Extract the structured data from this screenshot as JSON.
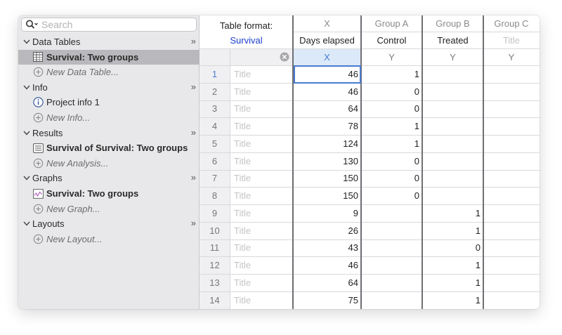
{
  "search": {
    "placeholder": "Search"
  },
  "sidebar": {
    "sections": [
      {
        "label": "Data Tables",
        "items": [
          {
            "label": "Survival: Two groups",
            "kind": "table",
            "selected": true,
            "bold": true
          },
          {
            "label": "New Data Table...",
            "kind": "new"
          }
        ]
      },
      {
        "label": "Info",
        "items": [
          {
            "label": "Project info 1",
            "kind": "info"
          },
          {
            "label": "New Info...",
            "kind": "new"
          }
        ]
      },
      {
        "label": "Results",
        "items": [
          {
            "label": "Survival of Survival: Two groups",
            "kind": "results",
            "bold": true
          },
          {
            "label": "New Analysis...",
            "kind": "new"
          }
        ]
      },
      {
        "label": "Graphs",
        "items": [
          {
            "label": "Survival: Two groups",
            "kind": "graph",
            "bold": true
          },
          {
            "label": "New Graph...",
            "kind": "new"
          }
        ]
      },
      {
        "label": "Layouts",
        "items": [
          {
            "label": "New Layout...",
            "kind": "new"
          }
        ]
      }
    ],
    "expand_glyph": "»"
  },
  "table": {
    "format_label": "Table format:",
    "format_value": "Survival",
    "columns": [
      {
        "head": "X",
        "name": "Days elapsed",
        "type": "X"
      },
      {
        "head": "Group A",
        "name": "Control",
        "type": "Y"
      },
      {
        "head": "Group B",
        "name": "Treated",
        "type": "Y"
      },
      {
        "head": "Group C",
        "name": "Title",
        "type": "Y",
        "placeholder": true
      }
    ],
    "title_placeholder": "Title",
    "rows": [
      {
        "n": "1",
        "x": "46",
        "a": "1",
        "b": ""
      },
      {
        "n": "2",
        "x": "46",
        "a": "0",
        "b": ""
      },
      {
        "n": "3",
        "x": "64",
        "a": "0",
        "b": ""
      },
      {
        "n": "4",
        "x": "78",
        "a": "1",
        "b": ""
      },
      {
        "n": "5",
        "x": "124",
        "a": "1",
        "b": ""
      },
      {
        "n": "6",
        "x": "130",
        "a": "0",
        "b": ""
      },
      {
        "n": "7",
        "x": "150",
        "a": "0",
        "b": ""
      },
      {
        "n": "8",
        "x": "150",
        "a": "0",
        "b": ""
      },
      {
        "n": "9",
        "x": "9",
        "a": "",
        "b": "1"
      },
      {
        "n": "10",
        "x": "26",
        "a": "",
        "b": "1"
      },
      {
        "n": "11",
        "x": "43",
        "a": "",
        "b": "0"
      },
      {
        "n": "12",
        "x": "46",
        "a": "",
        "b": "1"
      },
      {
        "n": "13",
        "x": "64",
        "a": "",
        "b": "1"
      },
      {
        "n": "14",
        "x": "75",
        "a": "",
        "b": "1"
      }
    ]
  },
  "colors": {
    "accent": "#4a7bd0",
    "link": "#1d3fc9",
    "selection": "#b9b9bd",
    "sidebar_bg": "#e8e8ea"
  }
}
